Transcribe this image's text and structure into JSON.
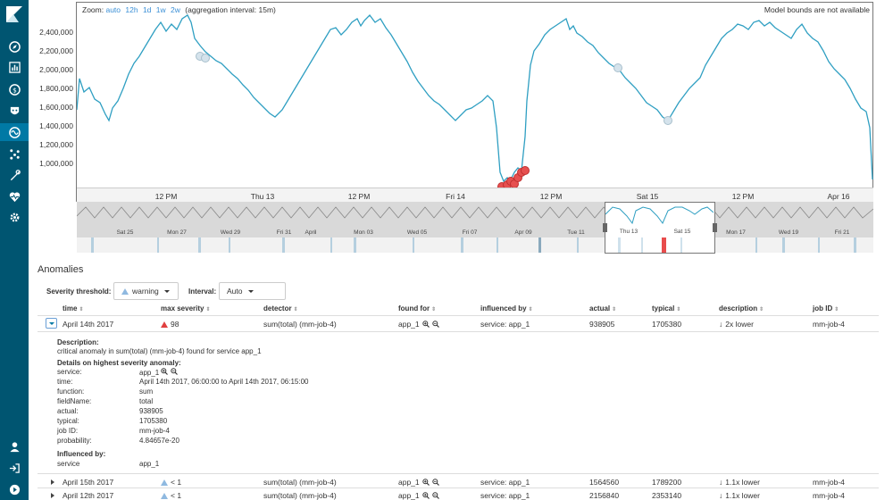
{
  "chart": {
    "zoom_label": "Zoom:",
    "zoom_options": [
      "auto",
      "12h",
      "1d",
      "1w",
      "2w"
    ],
    "aggregation": "(aggregation interval: 15m)",
    "bounds_note": "Model bounds are not available",
    "y_ticks": [
      "2,400,000",
      "2,200,000",
      "2,000,000",
      "1,800,000",
      "1,600,000",
      "1,400,000",
      "1,200,000",
      "1,000,000"
    ],
    "x_ticks": [
      "12 PM",
      "Thu 13",
      "12 PM",
      "Fri 14",
      "12 PM",
      "Sat 15",
      "12 PM",
      "Apr 16"
    ],
    "context_ticks": [
      "Sat 25",
      "Mon 27",
      "Wed 29",
      "Fri 31",
      "April",
      "Mon 03",
      "Wed 05",
      "Fri 07",
      "Apr 09",
      "Tue 11",
      "Thu 13",
      "Sat 15",
      "Mon 17",
      "Wed 19",
      "Fri 21"
    ],
    "line_color": "#2f9fc2",
    "anomaly_color": "#e65050"
  },
  "anomalies": {
    "title": "Anomalies",
    "severity_label": "Severity threshold:",
    "severity_value": "warning",
    "interval_label": "Interval:",
    "interval_value": "Auto",
    "columns": [
      "time",
      "max severity",
      "detector",
      "found for",
      "influenced by",
      "actual",
      "typical",
      "description",
      "job ID"
    ],
    "rows": [
      {
        "time": "April 14th 2017",
        "severity": "98",
        "detector": "sum(total) (mm-job-4)",
        "found_for": "app_1",
        "influenced": "service: app_1",
        "actual": "938905",
        "typical": "1705380",
        "description": "2x lower",
        "job": "mm-job-4"
      },
      {
        "time": "April 15th 2017",
        "severity": "< 1",
        "detector": "sum(total) (mm-job-4)",
        "found_for": "app_1",
        "influenced": "service: app_1",
        "actual": "1564560",
        "typical": "1789200",
        "description": "1.1x lower",
        "job": "mm-job-4"
      },
      {
        "time": "April 12th 2017",
        "severity": "< 1",
        "detector": "sum(total) (mm-job-4)",
        "found_for": "app_1",
        "influenced": "service: app_1",
        "actual": "2156840",
        "typical": "2353140",
        "description": "1.1x lower",
        "job": "mm-job-4"
      }
    ],
    "details": {
      "description_heading": "Description:",
      "description_text": "critical anomaly in sum(total) (mm-job-4) found for service app_1",
      "details_heading": "Details on highest severity anomaly:",
      "fields": [
        {
          "label": "service:",
          "value": "app_1"
        },
        {
          "label": "time:",
          "value": "April 14th 2017, 06:00:00 to April 14th 2017, 06:15:00"
        },
        {
          "label": "function:",
          "value": "sum"
        },
        {
          "label": "fieldName:",
          "value": "total"
        },
        {
          "label": "actual:",
          "value": "938905"
        },
        {
          "label": "typical:",
          "value": "1705380"
        },
        {
          "label": "job ID:",
          "value": "mm-job-4"
        },
        {
          "label": "probability:",
          "value": "4.84657e-20"
        }
      ],
      "influenced_heading": "Influenced by:",
      "influenced_label": "service",
      "influenced_value": "app_1"
    }
  },
  "sidebar": {
    "icons": [
      "discover-icon",
      "visualize-icon",
      "dashboard-icon",
      "timelion-icon",
      "machine-learning-icon",
      "graph-icon",
      "dev-tools-icon",
      "monitoring-icon",
      "management-icon",
      "user-icon",
      "logout-icon",
      "collapse-icon"
    ]
  }
}
